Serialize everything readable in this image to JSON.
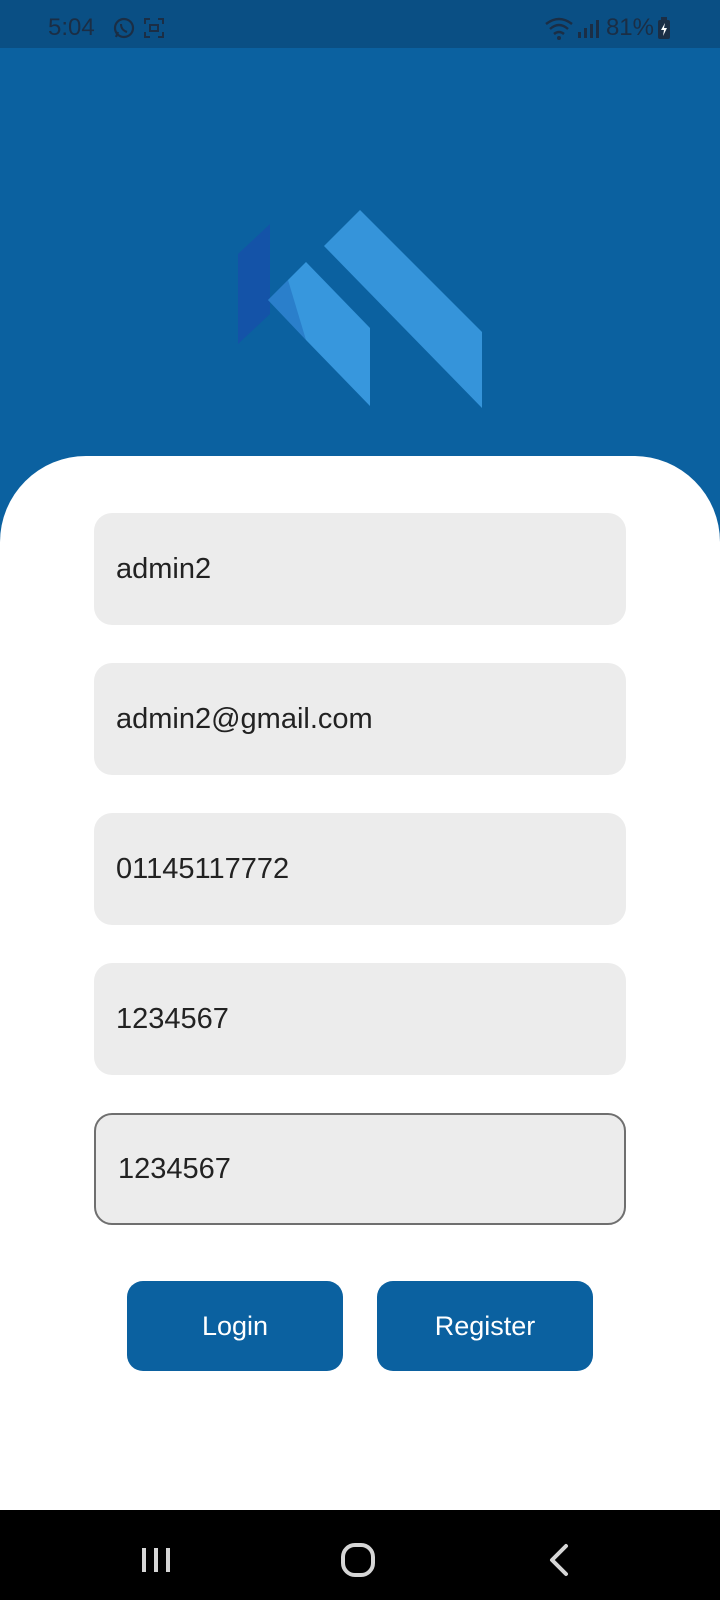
{
  "status_bar": {
    "time": "5:04",
    "battery": "81%",
    "icons": [
      "whatsapp-icon",
      "screen-record-icon",
      "wifi-icon",
      "signal-icon",
      "battery-charging-icon"
    ]
  },
  "logo": {
    "icon": "house-roof-logo-icon"
  },
  "form": {
    "username_value": "admin2",
    "email_value": "admin2@gmail.com",
    "phone_value": "01145117772",
    "password_value": "1234567",
    "confirm_password_value": "1234567"
  },
  "buttons": {
    "login_label": "Login",
    "register_label": "Register"
  },
  "nav_bar": {
    "icons": [
      "recent-apps-icon",
      "home-icon",
      "back-icon"
    ]
  },
  "colors": {
    "primary": "#0b61a0",
    "status_bar": "#0a4f84",
    "field_background": "#ececec",
    "card_background": "#ffffff",
    "logo_light": "#3a9ae0",
    "logo_dark": "#1552a8"
  }
}
